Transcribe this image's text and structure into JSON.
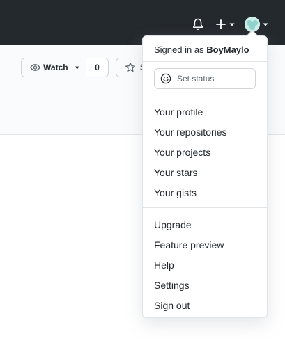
{
  "header": {
    "notifications_icon": "bell-icon",
    "create_icon": "plus-icon",
    "avatar_icon": "avatar-icon"
  },
  "repo_actions": {
    "watch_label": "Watch",
    "watch_count": "0",
    "star_label": "S"
  },
  "user_menu": {
    "signed_in_prefix": "Signed in as",
    "username": "BoyMaylo",
    "set_status": "Set status",
    "items_primary": [
      "Your profile",
      "Your repositories",
      "Your projects",
      "Your stars",
      "Your gists"
    ],
    "items_secondary": [
      "Upgrade",
      "Feature preview",
      "Help",
      "Settings",
      "Sign out"
    ]
  }
}
